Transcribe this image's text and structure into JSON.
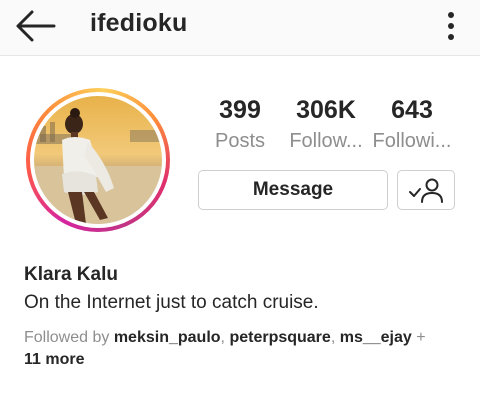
{
  "header": {
    "username": "ifedioku",
    "back_icon": "back-arrow-icon",
    "more_icon": "vertical-ellipsis-icon"
  },
  "profile": {
    "avatar_icon": "profile-photo"
  },
  "stats": [
    {
      "value": "399",
      "label": "Posts"
    },
    {
      "value": "306K",
      "label": "Follow..."
    },
    {
      "value": "643",
      "label": "Followi..."
    }
  ],
  "actions": {
    "message_label": "Message",
    "following_icon": "user-check-icon"
  },
  "bio": {
    "name": "Klara Kalu",
    "text": "On the Internet just to catch cruise."
  },
  "followed_by": {
    "prefix": "Followed by",
    "users": [
      "meksin_paulo",
      "peterpsquare",
      "ms__ejay"
    ],
    "separator": ",",
    "plus": "+",
    "more": "11 more"
  },
  "colors": {
    "text": "#262626",
    "muted": "#8e8e8e",
    "border": "#cfcfcf",
    "ring_gradient": [
      "#d6249f",
      "#fd5949",
      "#fdd05a"
    ]
  }
}
